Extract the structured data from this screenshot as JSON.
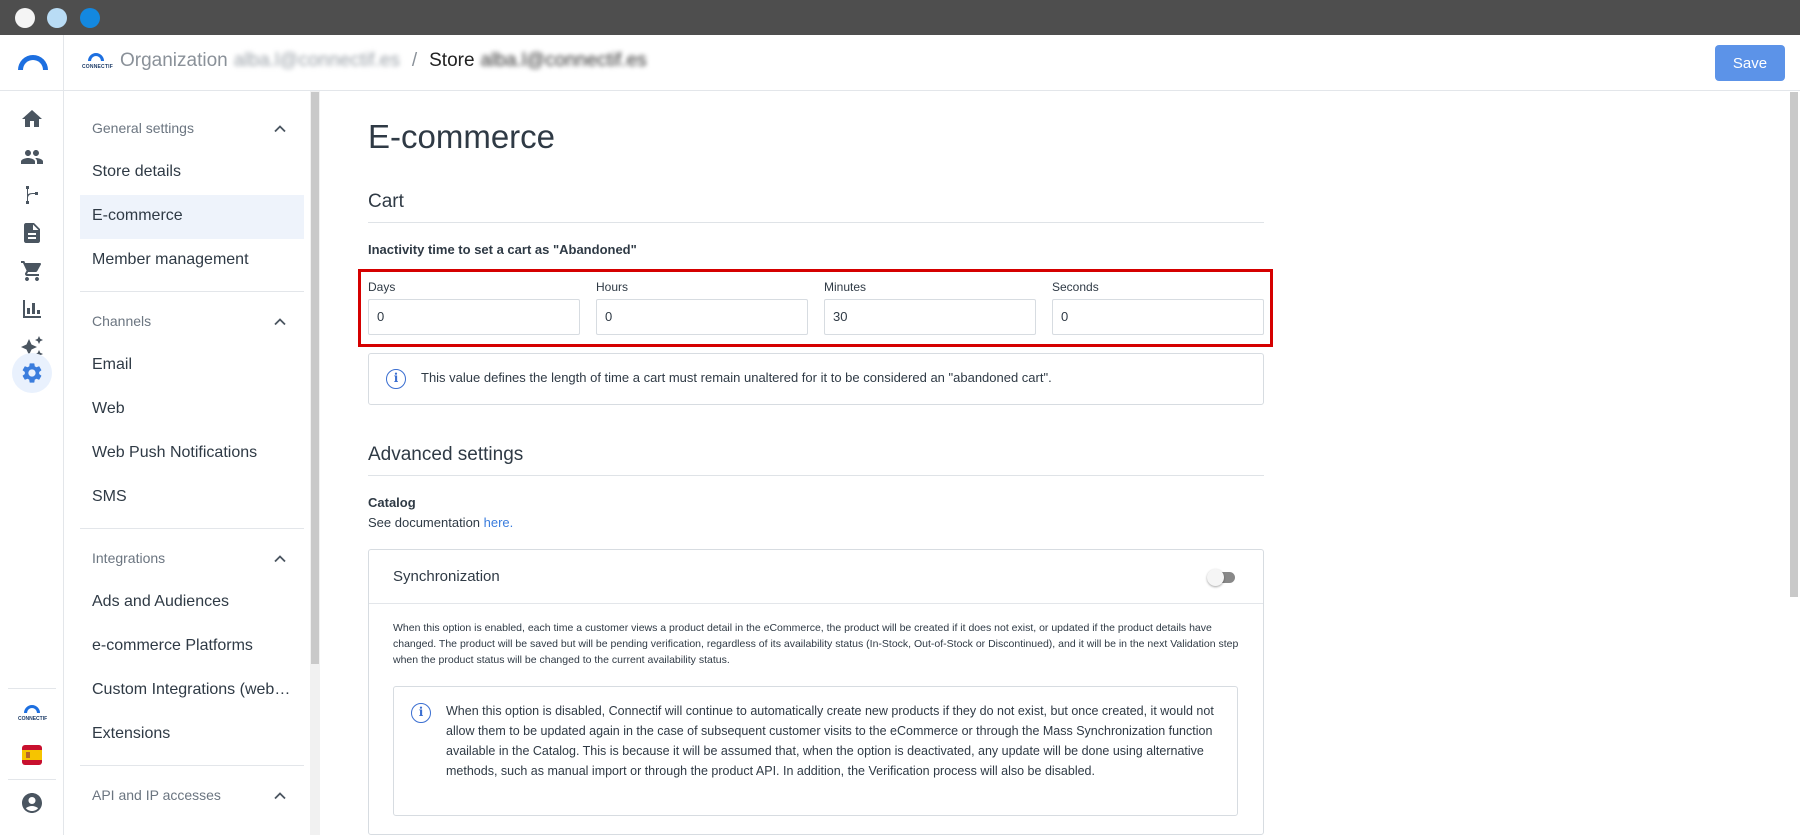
{
  "header": {
    "org_label": "Organization",
    "org_value": "alba.l@connectif.es",
    "separator": "/",
    "store_label": "Store",
    "store_value": "alba.l@connectif.es",
    "save_label": "Save",
    "logo_text": "CONNECTIF"
  },
  "rail": {
    "icons": [
      "home-icon",
      "people-icon",
      "flow-icon",
      "document-icon",
      "cart-icon",
      "bar-chart-icon",
      "sparkles-icon",
      "gear-icon"
    ],
    "active": "gear-icon",
    "bottom": [
      "connectif-logo",
      "spain-flag-icon",
      "account-icon"
    ]
  },
  "nav": {
    "sections": [
      {
        "label": "General settings",
        "items": [
          "Store details",
          "E-commerce",
          "Member management"
        ]
      },
      {
        "label": "Channels",
        "items": [
          "Email",
          "Web",
          "Web Push Notifications",
          "SMS"
        ]
      },
      {
        "label": "Integrations",
        "items": [
          "Ads and Audiences",
          "e-commerce Platforms",
          "Custom Integrations (webhooks)",
          "Extensions"
        ]
      },
      {
        "label": "API and IP accesses",
        "items": []
      }
    ],
    "active_item": "E-commerce"
  },
  "main": {
    "title": "E-commerce",
    "cart": {
      "title": "Cart",
      "caption": "Inactivity time to set a cart as \"Abandoned\"",
      "fields": [
        {
          "label": "Days",
          "value": "0"
        },
        {
          "label": "Hours",
          "value": "0"
        },
        {
          "label": "Minutes",
          "value": "30"
        },
        {
          "label": "Seconds",
          "value": "0"
        }
      ],
      "info": "This value defines the length of time a cart must remain unaltered for it to be considered an \"abandoned cart\"."
    },
    "advanced": {
      "title": "Advanced settings",
      "catalog_label": "Catalog",
      "doc_prefix": "See documentation ",
      "doc_link": "here.",
      "sync_title": "Synchronization",
      "sync_enabled": false,
      "sync_description": "When this option is enabled, each time a customer views a product detail in the eCommerce, the product will be created if it does not exist, or updated if the product details have changed. The product will be saved but will be pending verification, regardless of its availability status (In-Stock, Out-of-Stock or Discontinued), and it will be in the next Validation step when the product status will be changed to the current availability status.",
      "sync_note": "When this option is disabled, Connectif will continue to automatically create new products if they do not exist, but once created, it would not allow them to be updated again in the case of subsequent customer visits to the eCommerce or through the Mass Synchronization function available in the Catalog. This is because it will be assumed that, when the option is deactivated, any update will be done using alternative methods, such as manual import or through the product API. In addition, the Verification process will also be disabled."
    }
  },
  "colors": {
    "accent": "#5c93e8",
    "highlight_border": "#d50000",
    "info_icon": "#3b6fd1",
    "link": "#3b7ddd"
  }
}
